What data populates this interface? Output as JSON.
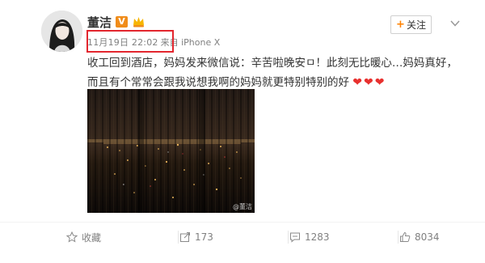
{
  "post": {
    "author": {
      "name": "董洁",
      "verified_badge": "V",
      "verified_color": "#f08c1a",
      "member_icon": "crown-member-icon",
      "avatar_icon": "avatar"
    },
    "time": "11月19日 22:02",
    "source": "来自 iPhone X",
    "follow_button": {
      "plus": "+",
      "label": "关注"
    },
    "text": "收工回到酒店，妈妈发来微信说：辛苦啦晚安ㅁ！此刻无比暖心…妈妈真好，而且有个常常会跟我说想我啊的妈妈就更特别特别的好",
    "hearts": "❤❤❤",
    "heart_color": "#e8302e",
    "highlight_color": "#e3262e",
    "image_watermark": "@董洁"
  },
  "actions": {
    "favorite": {
      "icon": "star-icon",
      "label": "收藏"
    },
    "share": {
      "icon": "share-icon",
      "count": "173"
    },
    "comment": {
      "icon": "comment-icon",
      "count": "1283"
    },
    "like": {
      "icon": "thumbs-up-icon",
      "count": "8034"
    }
  }
}
